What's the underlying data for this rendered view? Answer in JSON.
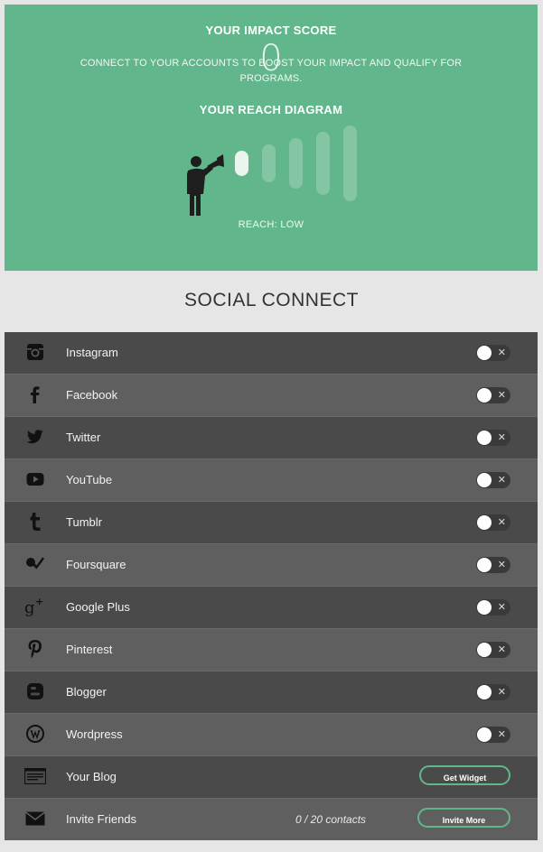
{
  "impact": {
    "title": "YOUR IMPACT SCORE",
    "score": "0",
    "description": "CONNECT TO YOUR ACCOUNTS TO BOOST YOUR IMPACT AND QUALIFY FOR PROGRAMS.",
    "reach_title": "YOUR REACH DIAGRAM",
    "reach_status": "REACH: LOW",
    "reach_level": 1,
    "reach_levels_total": 5
  },
  "social": {
    "title": "SOCIAL CONNECT",
    "items": [
      {
        "label": "Instagram",
        "icon": "instagram-icon",
        "connected": false
      },
      {
        "label": "Facebook",
        "icon": "facebook-icon",
        "connected": false
      },
      {
        "label": "Twitter",
        "icon": "twitter-icon",
        "connected": false
      },
      {
        "label": "YouTube",
        "icon": "youtube-icon",
        "connected": false
      },
      {
        "label": "Tumblr",
        "icon": "tumblr-icon",
        "connected": false
      },
      {
        "label": "Foursquare",
        "icon": "foursquare-icon",
        "connected": false
      },
      {
        "label": "Google Plus",
        "icon": "google-plus-icon",
        "connected": false
      },
      {
        "label": "Pinterest",
        "icon": "pinterest-icon",
        "connected": false
      },
      {
        "label": "Blogger",
        "icon": "blogger-icon",
        "connected": false
      },
      {
        "label": "Wordpress",
        "icon": "wordpress-icon",
        "connected": false
      }
    ],
    "toggle_off_symbol": "✕",
    "blog": {
      "label": "Your Blog",
      "button_label": "Get Widget"
    },
    "invite": {
      "label": "Invite Friends",
      "contacts": "0 / 20 contacts",
      "button_label": "Invite More"
    }
  },
  "colors": {
    "accent": "#62b68b",
    "row_dark": "#4a4a4a",
    "row_light": "#5f5f5f",
    "page_bg": "#e6e6e6"
  }
}
